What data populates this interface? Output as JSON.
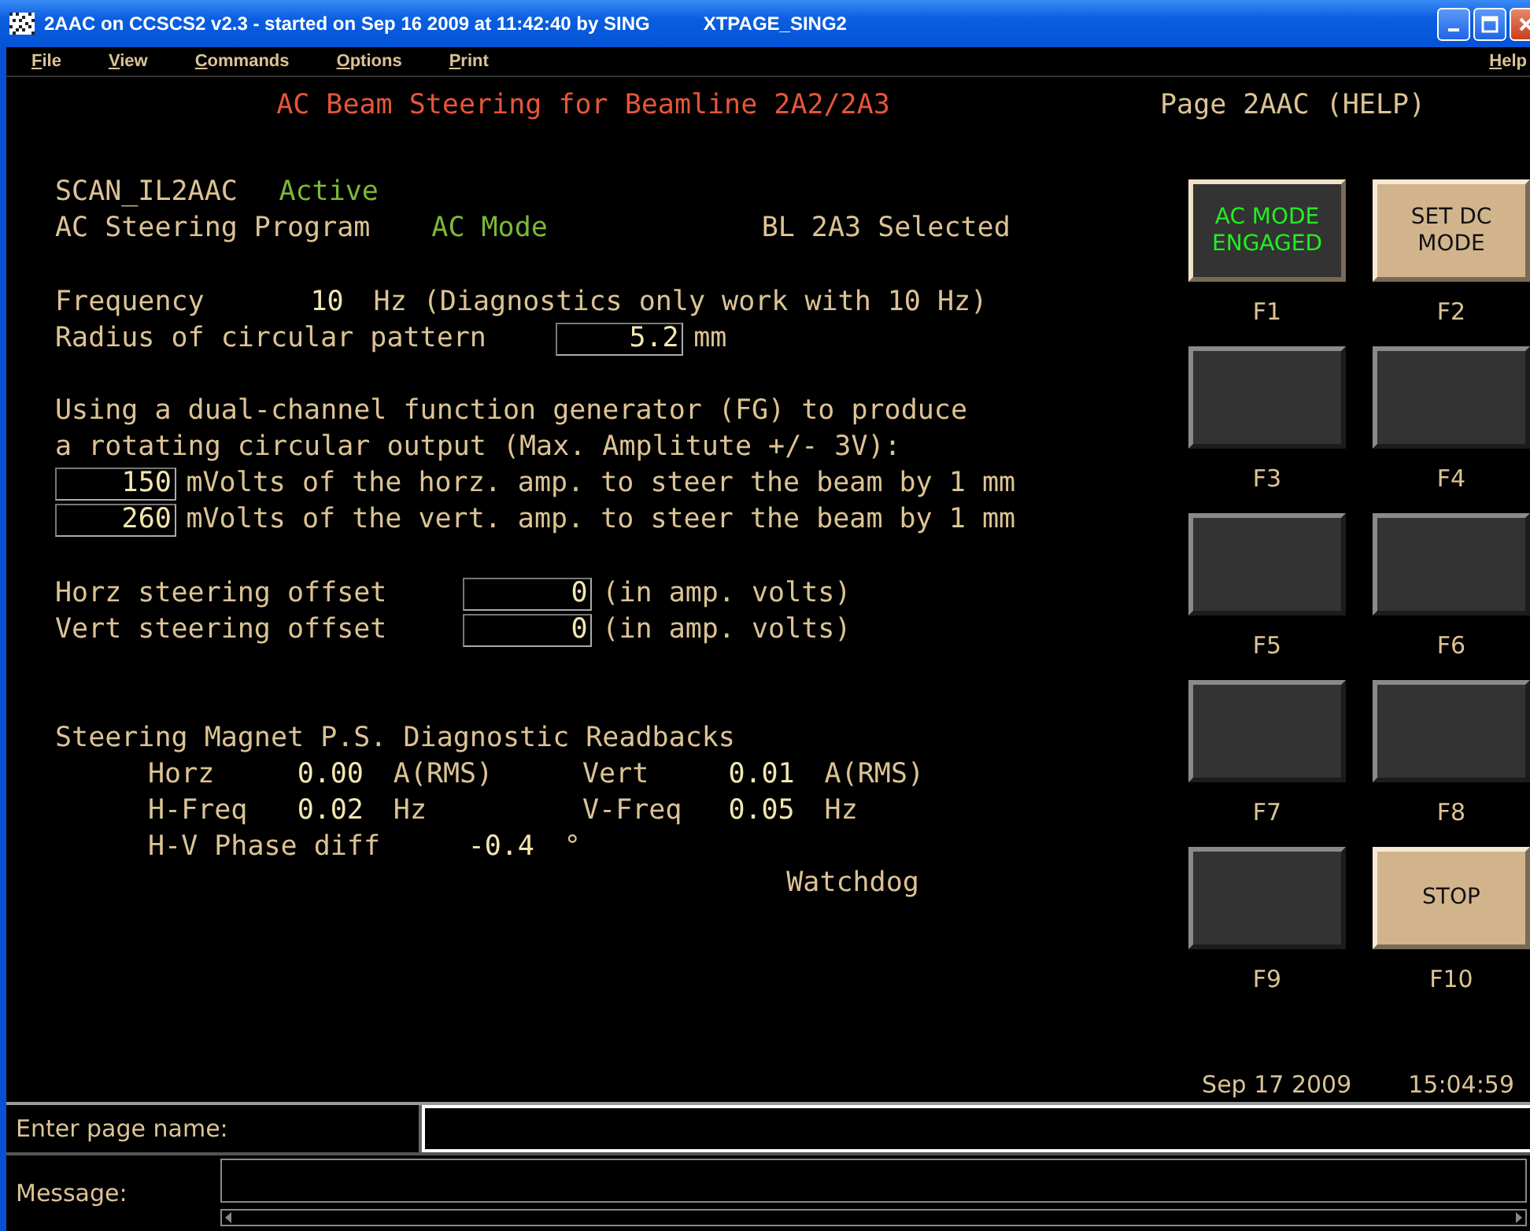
{
  "window": {
    "title": "2AAC on CCSCS2 v2.3 - started on Sep 16 2009 at 11:42:40 by SING",
    "display": "XTPAGE_SING2"
  },
  "menu": [
    {
      "label": "File"
    },
    {
      "label": "View"
    },
    {
      "label": "Commands"
    },
    {
      "label": "Options"
    },
    {
      "label": "Print"
    }
  ],
  "help_menu": {
    "label": "Help"
  },
  "header": {
    "title": "AC Beam Steering for Beamline 2A2/2A3",
    "page": "Page 2AAC (HELP)"
  },
  "groups": [
    [
      {
        "cells": [
          {
            "text": "SCAN_IL2AAC",
            "kind": "label"
          },
          {
            "text": "Active",
            "kind": "status"
          }
        ]
      },
      {
        "cells": [
          {
            "text": "AC Steering Program",
            "kind": "label"
          },
          {
            "text": "AC Mode",
            "kind": "status"
          },
          {
            "text": "BL 2A3 Selected",
            "kind": "label"
          }
        ]
      }
    ],
    [
      {
        "cells": [
          {
            "text": "Frequency",
            "kind": "label"
          },
          {
            "text": "10",
            "kind": "value"
          },
          {
            "text": "Hz (Diagnostics only work with 10 Hz)",
            "kind": "label"
          }
        ]
      },
      {
        "cells": [
          {
            "text": "Radius of circular pattern",
            "kind": "label"
          },
          {
            "text": "5.2",
            "kind": "field"
          },
          {
            "text": "mm",
            "kind": "label"
          }
        ]
      }
    ],
    [
      {
        "cells": [
          {
            "text": "Using a dual-channel function generator (FG) to produce",
            "kind": "label"
          }
        ]
      },
      {
        "cells": [
          {
            "text": "a rotating circular output (Max. Amplitute +/- 3V):",
            "kind": "label"
          }
        ]
      },
      {
        "cells": [
          {
            "text": "150",
            "kind": "field"
          },
          {
            "text": "mVolts of the horz. amp. to steer the beam by 1 mm",
            "kind": "label"
          }
        ]
      },
      {
        "cells": [
          {
            "text": "260",
            "kind": "field"
          },
          {
            "text": "mVolts of the vert. amp. to steer the beam by 1 mm",
            "kind": "label"
          }
        ]
      }
    ],
    [
      {
        "cells": [
          {
            "text": "Horz steering offset",
            "kind": "label"
          },
          {
            "text": "0",
            "kind": "field"
          },
          {
            "text": "(in amp. volts)",
            "kind": "label"
          }
        ]
      },
      {
        "cells": [
          {
            "text": "Vert steering offset",
            "kind": "label"
          },
          {
            "text": "0",
            "kind": "field"
          },
          {
            "text": "(in amp. volts)",
            "kind": "label"
          }
        ]
      }
    ],
    [
      {
        "cells": [
          {
            "text": "Steering Magnet P.S. Diagnostic Readbacks",
            "kind": "label"
          }
        ]
      },
      {
        "cells": [
          {
            "text": "Horz",
            "kind": "label"
          },
          {
            "text": "0.00",
            "kind": "value"
          },
          {
            "text": "A(RMS)",
            "kind": "label"
          },
          {
            "text": "Vert",
            "kind": "label"
          },
          {
            "text": "0.01",
            "kind": "value"
          },
          {
            "text": "A(RMS)",
            "kind": "label"
          }
        ]
      },
      {
        "cells": [
          {
            "text": "H-Freq",
            "kind": "label"
          },
          {
            "text": "0.02",
            "kind": "value"
          },
          {
            "text": "Hz",
            "kind": "label"
          },
          {
            "text": "V-Freq",
            "kind": "label"
          },
          {
            "text": "0.05",
            "kind": "value"
          },
          {
            "text": "Hz",
            "kind": "label"
          }
        ]
      },
      {
        "cells": [
          {
            "text": "H-V Phase diff",
            "kind": "label"
          },
          {
            "text": "-0.4",
            "kind": "value"
          },
          {
            "text": "°",
            "kind": "label"
          }
        ]
      },
      {
        "cells": [
          {
            "text": "Watchdog",
            "kind": "label"
          }
        ]
      }
    ]
  ],
  "function_key_rows": [
    {
      "keys": [
        {
          "key": "F1",
          "label": "AC MODE ENGAGED",
          "kind": "engaged"
        },
        {
          "key": "F2",
          "label": "SET DC MODE",
          "kind": "command"
        }
      ]
    },
    {
      "keys": [
        {
          "key": "F3",
          "kind": "blank"
        },
        {
          "key": "F4",
          "kind": "blank"
        }
      ]
    },
    {
      "keys": [
        {
          "key": "F5",
          "kind": "blank"
        },
        {
          "key": "F6",
          "kind": "blank"
        }
      ]
    },
    {
      "keys": [
        {
          "key": "F7",
          "kind": "blank"
        },
        {
          "key": "F8",
          "kind": "blank"
        }
      ]
    },
    {
      "keys": [
        {
          "key": "F9",
          "kind": "blank"
        },
        {
          "key": "F10",
          "label": "STOP",
          "kind": "command"
        }
      ]
    }
  ],
  "clock": {
    "date": "Sep 17 2009",
    "time": "15:04:59"
  },
  "page_entry": {
    "label": "Enter page name:"
  },
  "message": {
    "label": "Message:"
  }
}
